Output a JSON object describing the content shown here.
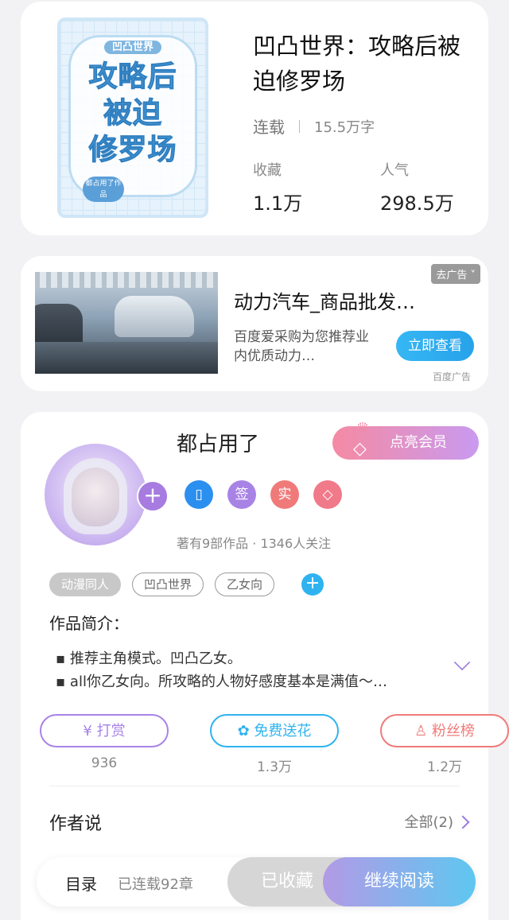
{
  "book": {
    "cover": {
      "series": "凹凸世界",
      "title_lines": [
        "攻略后",
        "被迫",
        "修罗场"
      ],
      "author_badge": "都占用了作品"
    },
    "title": "凹凸世界：攻略后被迫修罗场",
    "status": "连载",
    "word_count": "15.5万字",
    "stats": [
      {
        "label": "收藏",
        "value": "1.1万"
      },
      {
        "label": "人气",
        "value": "298.5万"
      }
    ]
  },
  "ad": {
    "tag": "去广告",
    "title": "动力汽车_商品批发…",
    "description": "百度爱采购为您推荐业内优质动力…",
    "button": "立即查看",
    "source": "百度广告"
  },
  "author": {
    "name": "都占用了",
    "vip_button": "点亮会员",
    "badges": [
      {
        "icon": "phone-icon",
        "text": "▯",
        "color": "#2b8ff0"
      },
      {
        "icon": "sign-icon",
        "text": "签",
        "color": "#a883e6"
      },
      {
        "icon": "verified-icon",
        "text": "实",
        "color": "#f07a7a"
      },
      {
        "icon": "diamond-icon",
        "text": "◇",
        "color": "#f07a8a"
      }
    ],
    "info": "著有9部作品 · 1346人关注",
    "tags": [
      "动漫同人",
      "凹凸世界",
      "乙女向"
    ]
  },
  "intro": {
    "heading": "作品简介：",
    "lines": [
      "▪ 推荐主角模式。凹凸乙女。",
      "▪ all你乙女向。所攻略的人物好感度基本是满值～…"
    ]
  },
  "actions": [
    {
      "label": "打赏",
      "icon": "yen-icon",
      "count": "936",
      "color": "#a883e6"
    },
    {
      "label": "免费送花",
      "icon": "flower-icon",
      "count": "1.3万",
      "color": "#2fb3f0"
    },
    {
      "label": "粉丝榜",
      "icon": "fans-icon",
      "count": "1.2万",
      "color": "#f07a7a"
    }
  ],
  "author_says": {
    "title": "作者说",
    "all": "全部(2)"
  },
  "bottom_bar": {
    "toc": "目录",
    "updated": "已连载92章",
    "favorited": "已收藏",
    "continue": "继续阅读"
  }
}
